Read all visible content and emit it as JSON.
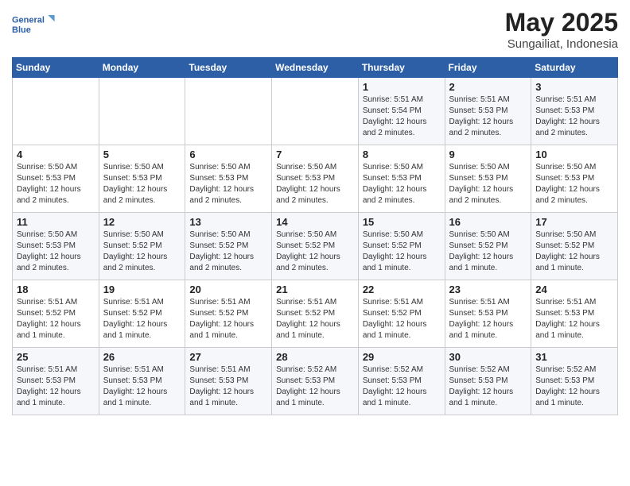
{
  "header": {
    "logo_line1": "General",
    "logo_line2": "Blue",
    "month_year": "May 2025",
    "location": "Sungailiat, Indonesia"
  },
  "weekdays": [
    "Sunday",
    "Monday",
    "Tuesday",
    "Wednesday",
    "Thursday",
    "Friday",
    "Saturday"
  ],
  "weeks": [
    [
      {
        "day": "",
        "info": ""
      },
      {
        "day": "",
        "info": ""
      },
      {
        "day": "",
        "info": ""
      },
      {
        "day": "",
        "info": ""
      },
      {
        "day": "1",
        "info": "Sunrise: 5:51 AM\nSunset: 5:54 PM\nDaylight: 12 hours and 2 minutes."
      },
      {
        "day": "2",
        "info": "Sunrise: 5:51 AM\nSunset: 5:53 PM\nDaylight: 12 hours and 2 minutes."
      },
      {
        "day": "3",
        "info": "Sunrise: 5:51 AM\nSunset: 5:53 PM\nDaylight: 12 hours and 2 minutes."
      }
    ],
    [
      {
        "day": "4",
        "info": "Sunrise: 5:50 AM\nSunset: 5:53 PM\nDaylight: 12 hours and 2 minutes."
      },
      {
        "day": "5",
        "info": "Sunrise: 5:50 AM\nSunset: 5:53 PM\nDaylight: 12 hours and 2 minutes."
      },
      {
        "day": "6",
        "info": "Sunrise: 5:50 AM\nSunset: 5:53 PM\nDaylight: 12 hours and 2 minutes."
      },
      {
        "day": "7",
        "info": "Sunrise: 5:50 AM\nSunset: 5:53 PM\nDaylight: 12 hours and 2 minutes."
      },
      {
        "day": "8",
        "info": "Sunrise: 5:50 AM\nSunset: 5:53 PM\nDaylight: 12 hours and 2 minutes."
      },
      {
        "day": "9",
        "info": "Sunrise: 5:50 AM\nSunset: 5:53 PM\nDaylight: 12 hours and 2 minutes."
      },
      {
        "day": "10",
        "info": "Sunrise: 5:50 AM\nSunset: 5:53 PM\nDaylight: 12 hours and 2 minutes."
      }
    ],
    [
      {
        "day": "11",
        "info": "Sunrise: 5:50 AM\nSunset: 5:53 PM\nDaylight: 12 hours and 2 minutes."
      },
      {
        "day": "12",
        "info": "Sunrise: 5:50 AM\nSunset: 5:52 PM\nDaylight: 12 hours and 2 minutes."
      },
      {
        "day": "13",
        "info": "Sunrise: 5:50 AM\nSunset: 5:52 PM\nDaylight: 12 hours and 2 minutes."
      },
      {
        "day": "14",
        "info": "Sunrise: 5:50 AM\nSunset: 5:52 PM\nDaylight: 12 hours and 2 minutes."
      },
      {
        "day": "15",
        "info": "Sunrise: 5:50 AM\nSunset: 5:52 PM\nDaylight: 12 hours and 1 minute."
      },
      {
        "day": "16",
        "info": "Sunrise: 5:50 AM\nSunset: 5:52 PM\nDaylight: 12 hours and 1 minute."
      },
      {
        "day": "17",
        "info": "Sunrise: 5:50 AM\nSunset: 5:52 PM\nDaylight: 12 hours and 1 minute."
      }
    ],
    [
      {
        "day": "18",
        "info": "Sunrise: 5:51 AM\nSunset: 5:52 PM\nDaylight: 12 hours and 1 minute."
      },
      {
        "day": "19",
        "info": "Sunrise: 5:51 AM\nSunset: 5:52 PM\nDaylight: 12 hours and 1 minute."
      },
      {
        "day": "20",
        "info": "Sunrise: 5:51 AM\nSunset: 5:52 PM\nDaylight: 12 hours and 1 minute."
      },
      {
        "day": "21",
        "info": "Sunrise: 5:51 AM\nSunset: 5:52 PM\nDaylight: 12 hours and 1 minute."
      },
      {
        "day": "22",
        "info": "Sunrise: 5:51 AM\nSunset: 5:52 PM\nDaylight: 12 hours and 1 minute."
      },
      {
        "day": "23",
        "info": "Sunrise: 5:51 AM\nSunset: 5:53 PM\nDaylight: 12 hours and 1 minute."
      },
      {
        "day": "24",
        "info": "Sunrise: 5:51 AM\nSunset: 5:53 PM\nDaylight: 12 hours and 1 minute."
      }
    ],
    [
      {
        "day": "25",
        "info": "Sunrise: 5:51 AM\nSunset: 5:53 PM\nDaylight: 12 hours and 1 minute."
      },
      {
        "day": "26",
        "info": "Sunrise: 5:51 AM\nSunset: 5:53 PM\nDaylight: 12 hours and 1 minute."
      },
      {
        "day": "27",
        "info": "Sunrise: 5:51 AM\nSunset: 5:53 PM\nDaylight: 12 hours and 1 minute."
      },
      {
        "day": "28",
        "info": "Sunrise: 5:52 AM\nSunset: 5:53 PM\nDaylight: 12 hours and 1 minute."
      },
      {
        "day": "29",
        "info": "Sunrise: 5:52 AM\nSunset: 5:53 PM\nDaylight: 12 hours and 1 minute."
      },
      {
        "day": "30",
        "info": "Sunrise: 5:52 AM\nSunset: 5:53 PM\nDaylight: 12 hours and 1 minute."
      },
      {
        "day": "31",
        "info": "Sunrise: 5:52 AM\nSunset: 5:53 PM\nDaylight: 12 hours and 1 minute."
      }
    ]
  ]
}
